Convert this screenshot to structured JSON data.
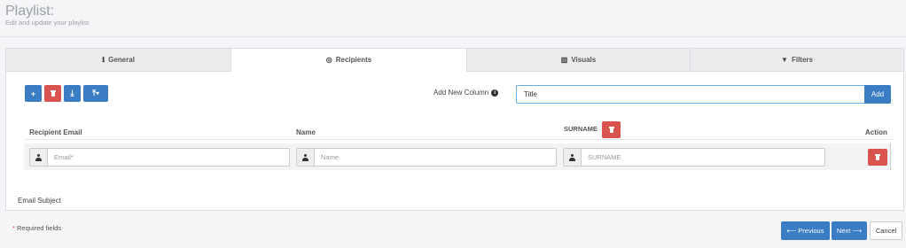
{
  "header": {
    "title": "Playlist:",
    "subtitle": "Edit and update your playlist"
  },
  "tabs": [
    {
      "label": "General",
      "icon": "info-icon",
      "glyph": "ℹ"
    },
    {
      "label": "Recipients",
      "icon": "target-icon",
      "glyph": "◎"
    },
    {
      "label": "Visuals",
      "icon": "bar-chart-icon",
      "glyph": "▥"
    },
    {
      "label": "Filters",
      "icon": "filter-icon",
      "glyph": "▼"
    }
  ],
  "toolbar": {
    "add_glyph": "+",
    "download_glyph": "⤓",
    "upload_glyph": "⤒▾"
  },
  "add_column": {
    "label": "Add New Column",
    "value": "Title",
    "button": "Add"
  },
  "table": {
    "columns": {
      "email": "Recipient Email",
      "name": "Name",
      "surname": "SURNAME",
      "action": "Action"
    },
    "placeholders": {
      "email": "Email*",
      "name": "Name",
      "surname": "SURNAME"
    }
  },
  "email_subject_label": "Email Subject",
  "footer": {
    "required_star": "*",
    "required_text": "Required fields",
    "previous": "Previous",
    "next": "Next",
    "cancel": "Cancel"
  },
  "colors": {
    "primary": "#3a7dc4",
    "danger": "#d9534f"
  }
}
